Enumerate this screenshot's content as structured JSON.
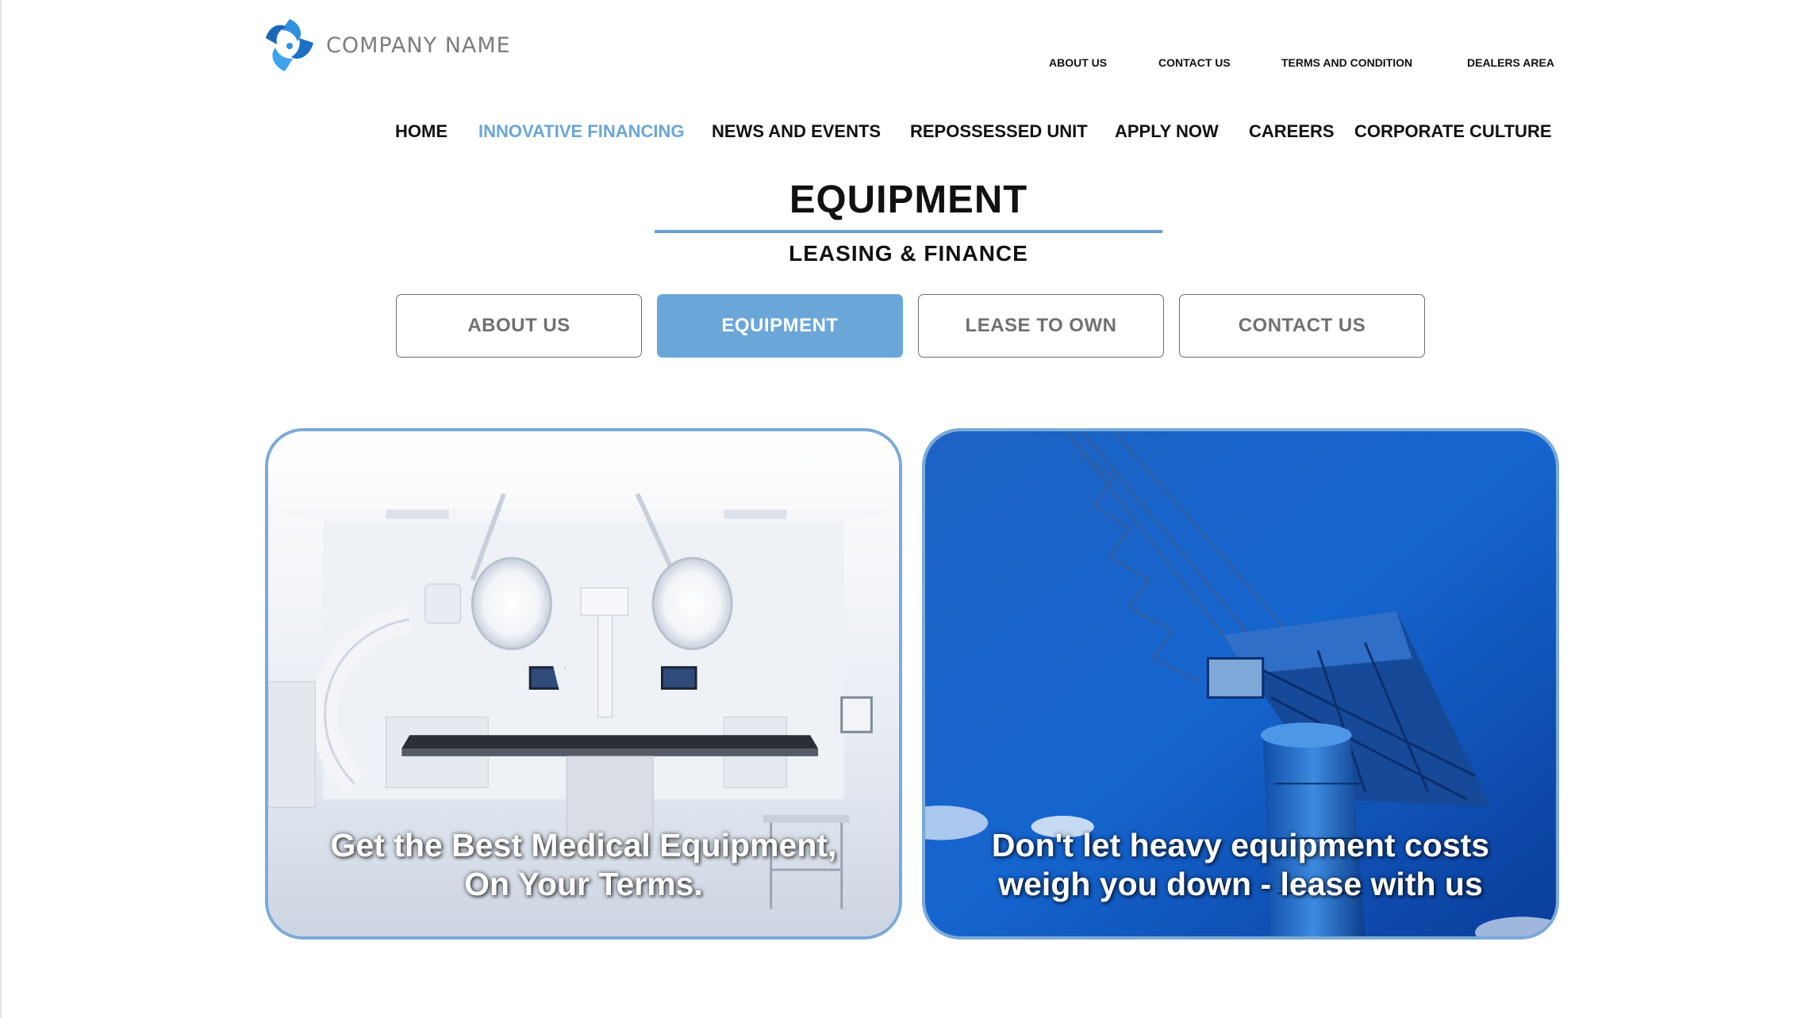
{
  "brand": {
    "name": "COMPANY NAME"
  },
  "top_nav": [
    {
      "label": "ABOUT US"
    },
    {
      "label": "CONTACT US"
    },
    {
      "label": "TERMS AND CONDITION"
    },
    {
      "label": "DEALERS AREA"
    }
  ],
  "main_nav": [
    {
      "label": "HOME"
    },
    {
      "label": "INNOVATIVE FINANCING",
      "active": true
    },
    {
      "label": "NEWS AND EVENTS"
    },
    {
      "label": "REPOSSESSED UNIT"
    },
    {
      "label": "APPLY NOW"
    },
    {
      "label": "CAREERS"
    },
    {
      "label": "CORPORATE CULTURE"
    }
  ],
  "heading": {
    "title": "EQUIPMENT",
    "subtitle": "LEASING & FINANCE"
  },
  "tabs": [
    {
      "label": "ABOUT  US"
    },
    {
      "label": "EQUIPMENT",
      "active": true
    },
    {
      "label": "LEASE TO OWN"
    },
    {
      "label": "CONTACT  US"
    }
  ],
  "cards": [
    {
      "caption_line1": "Get the Best Medical Equipment,",
      "caption_line2": "On Your Terms."
    },
    {
      "caption_line1": "Don't let heavy equipment costs",
      "caption_line2": "weigh you down - lease with us"
    }
  ],
  "colors": {
    "accent": "#6aa6d8",
    "card_border": "#7aaad8",
    "logo_blue": "#2f8fe0"
  }
}
